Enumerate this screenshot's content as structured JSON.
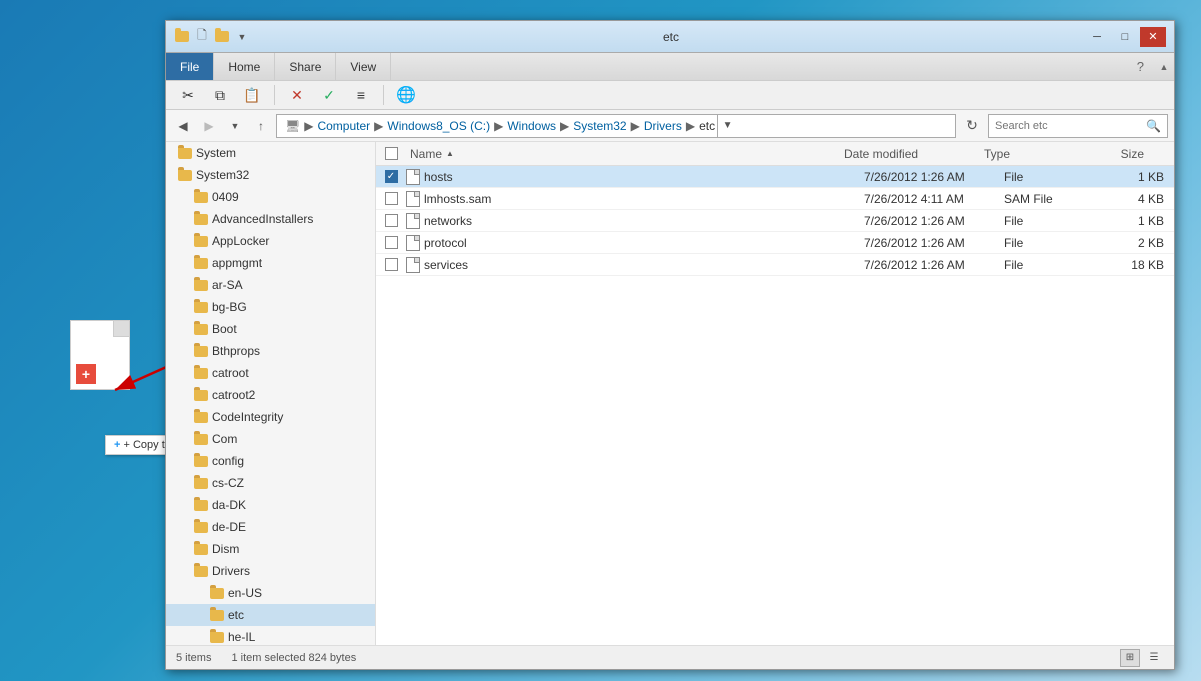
{
  "desktop": {
    "background": "#1e8bc3"
  },
  "copy_tooltip": "+ Copy to Desktop",
  "window": {
    "title": "etc",
    "title_icons": [
      "folder-small",
      "new-folder",
      "folder-up",
      "dropdown"
    ],
    "controls": {
      "minimize": "─",
      "maximize": "□",
      "close": "✕"
    }
  },
  "ribbon": {
    "tabs": [
      "File",
      "Home",
      "Share",
      "View"
    ],
    "active_tab": "File",
    "help_icon": "?"
  },
  "toolbar": {
    "icons": [
      {
        "name": "cut",
        "symbol": "✂",
        "enabled": true
      },
      {
        "name": "copy",
        "symbol": "⧉",
        "enabled": true
      },
      {
        "name": "paste",
        "symbol": "📋",
        "enabled": true
      },
      {
        "name": "delete",
        "symbol": "✕",
        "enabled": true,
        "color": "red"
      },
      {
        "name": "check",
        "symbol": "✓",
        "enabled": true,
        "color": "green"
      },
      {
        "name": "lines",
        "symbol": "≡",
        "enabled": true
      },
      {
        "name": "globe",
        "symbol": "🌐",
        "enabled": true
      }
    ]
  },
  "address_bar": {
    "back_enabled": true,
    "forward_enabled": false,
    "up_enabled": true,
    "breadcrumb": [
      "Computer",
      "Windows8_OS (C:)",
      "Windows",
      "System32",
      "Drivers",
      "etc"
    ],
    "search_placeholder": "Search etc"
  },
  "sidebar": {
    "items": [
      "System",
      "System32",
      "0409",
      "AdvancedInstallers",
      "AppLocker",
      "appmgmt",
      "ar-SA",
      "bg-BG",
      "Boot",
      "Bthprops",
      "catroot",
      "catroot2",
      "CodeIntegrity",
      "Com",
      "config",
      "cs-CZ",
      "da-DK",
      "de-DE",
      "Dism",
      "Drivers",
      "en-US",
      "etc",
      "he-IL"
    ],
    "selected": "etc"
  },
  "file_list": {
    "columns": {
      "name": "Name",
      "date_modified": "Date modified",
      "type": "Type",
      "size": "Size"
    },
    "sort_column": "Name",
    "sort_direction": "asc",
    "files": [
      {
        "name": "hosts",
        "date_modified": "7/26/2012 1:26 AM",
        "type": "File",
        "size": "1 KB",
        "selected": true,
        "checked": true
      },
      {
        "name": "lmhosts.sam",
        "date_modified": "7/26/2012 4:11 AM",
        "type": "SAM File",
        "size": "4 KB",
        "selected": false,
        "checked": false
      },
      {
        "name": "networks",
        "date_modified": "7/26/2012 1:26 AM",
        "type": "File",
        "size": "1 KB",
        "selected": false,
        "checked": false
      },
      {
        "name": "protocol",
        "date_modified": "7/26/2012 1:26 AM",
        "type": "File",
        "size": "2 KB",
        "selected": false,
        "checked": false
      },
      {
        "name": "services",
        "date_modified": "7/26/2012 1:26 AM",
        "type": "File",
        "size": "18 KB",
        "selected": false,
        "checked": false
      }
    ]
  },
  "status_bar": {
    "item_count": "5 items",
    "selection": "1 item selected  824 bytes"
  }
}
